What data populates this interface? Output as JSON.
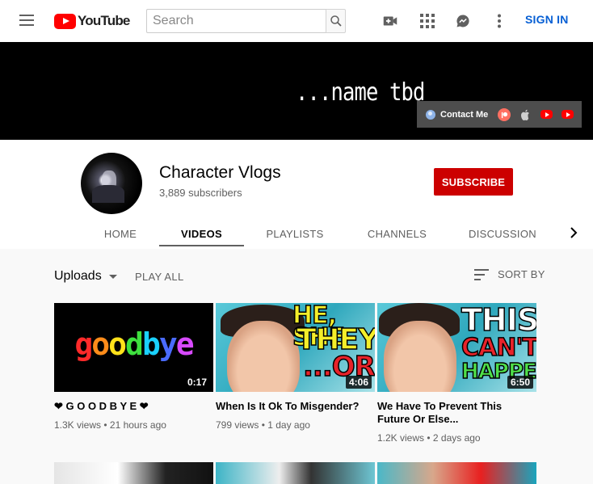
{
  "header": {
    "logo_text": "YouTube",
    "search_placeholder": "Search",
    "sign_in": "SIGN IN"
  },
  "banner": {
    "title": "...name tbd",
    "contact_label": "Contact Me"
  },
  "channel": {
    "name": "Character Vlogs",
    "subscribers": "3,889 subscribers",
    "subscribe_label": "SUBSCRIBE"
  },
  "tabs": [
    {
      "label": "HOME",
      "active": false
    },
    {
      "label": "VIDEOS",
      "active": true
    },
    {
      "label": "PLAYLISTS",
      "active": false
    },
    {
      "label": "CHANNELS",
      "active": false
    },
    {
      "label": "DISCUSSION",
      "active": false
    }
  ],
  "toolbar": {
    "uploads": "Uploads",
    "play_all": "PLAY ALL",
    "sort_by": "SORT BY"
  },
  "videos": [
    {
      "thumb_text": "goodbye",
      "duration": "0:17",
      "title": "❤ G O O D B Y E ❤",
      "meta": "1.3K views • 21 hours ago"
    },
    {
      "thumb_text_lines": [
        "HE, SHE",
        "THEY",
        "...OR?"
      ],
      "duration": "4:06",
      "title": "When Is It Ok To Misgender?",
      "meta": "799 views • 1 day ago"
    },
    {
      "thumb_text_lines": [
        "THIS",
        "CAN'T",
        "HAPPEN"
      ],
      "duration": "6:50",
      "title": "We Have To Prevent This Future Or Else...",
      "meta": "1.2K views • 2 days ago"
    }
  ],
  "colors": {
    "brand_red": "#ff0000",
    "subscribe_red": "#cc0000",
    "sign_in_blue": "#065fd4"
  }
}
